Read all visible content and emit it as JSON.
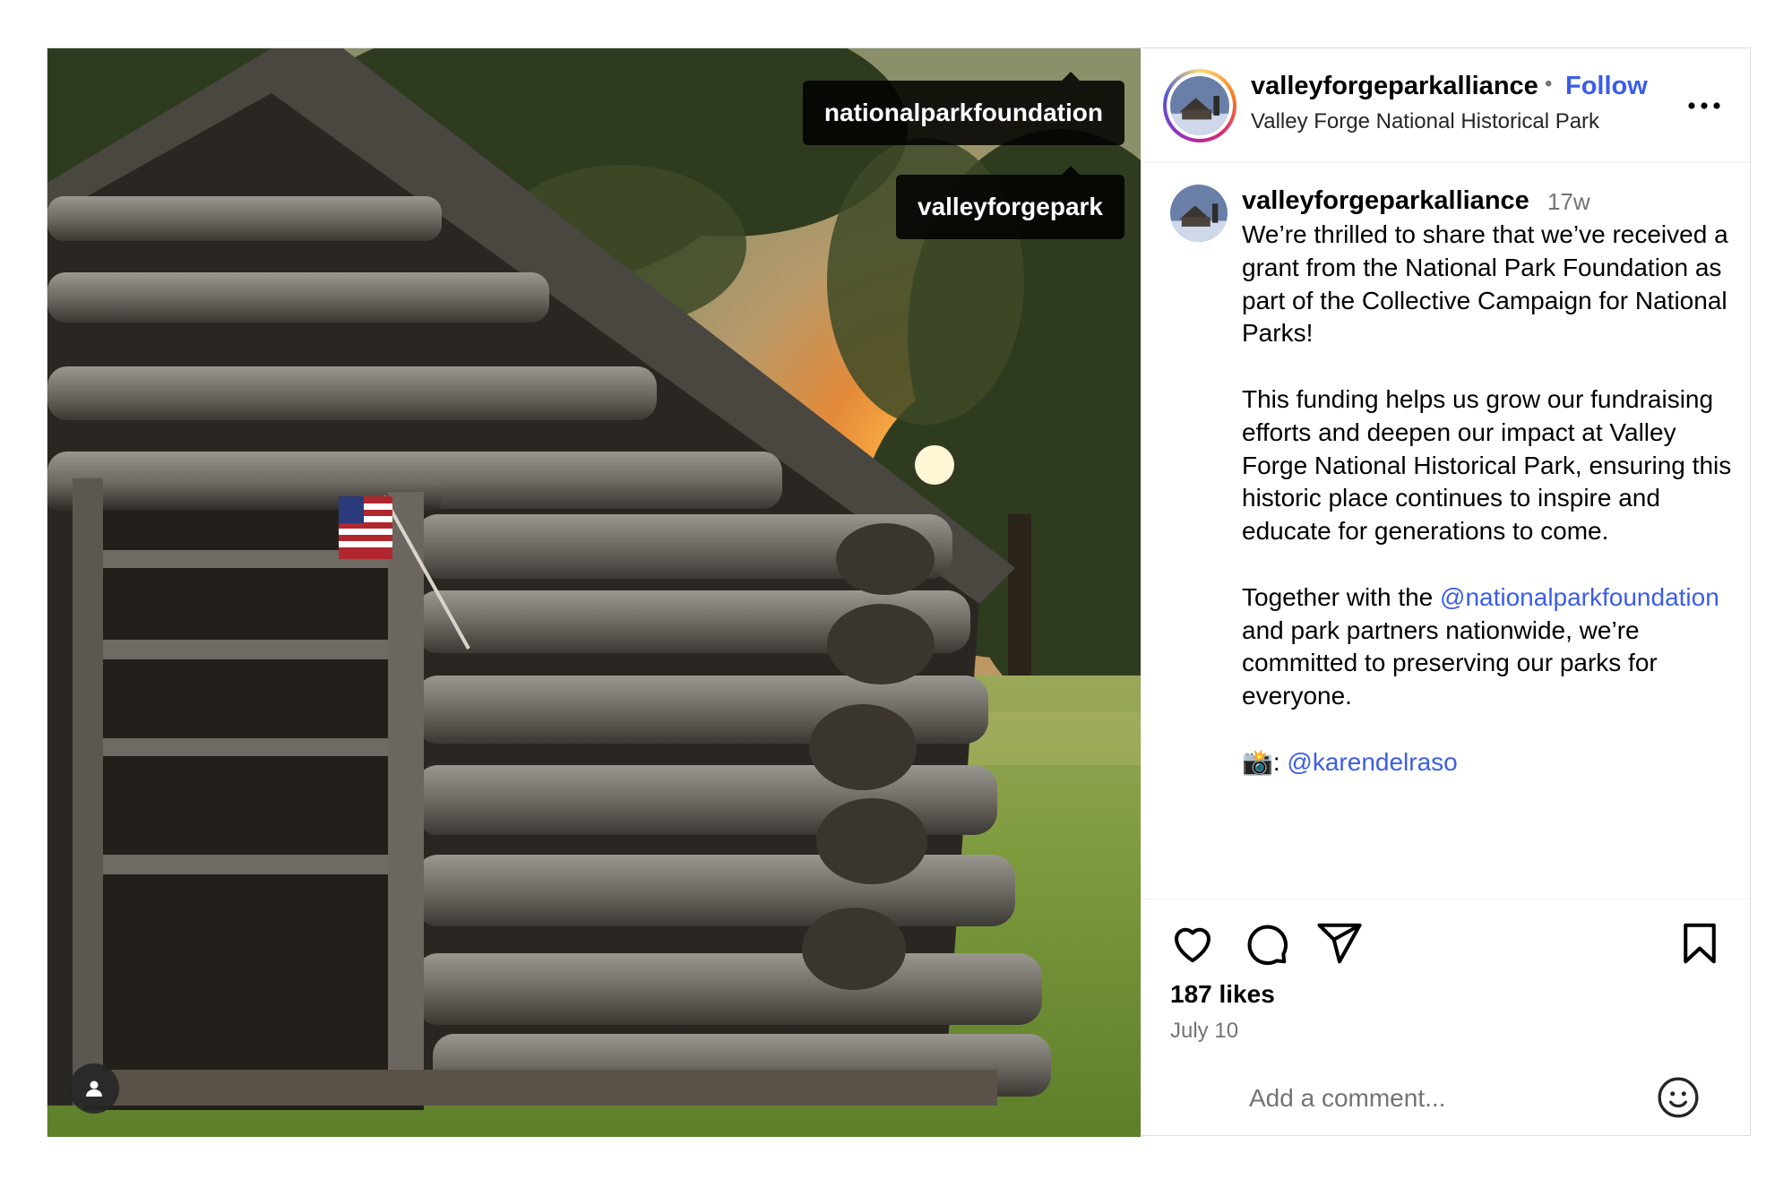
{
  "post": {
    "account": {
      "username": "valleyforgeparkalliance",
      "separator": "•",
      "follow_label": "Follow",
      "location": "Valley Forge National Historical Park"
    },
    "media": {
      "tags": [
        "nationalparkfoundation",
        "valleyforgepark"
      ]
    },
    "caption": {
      "username": "valleyforgeparkalliance",
      "time_ago": "17w",
      "paragraph_1": "We’re thrilled to share that we’ve received a grant from the National Park Foundation as part of the Collective Campaign for National Parks!",
      "paragraph_2": "This funding helps us grow our fundraising efforts and deepen our impact at Valley Forge National Historical Park, ensuring this historic place continues to inspire and educate for generations to come.",
      "paragraph_3_before": "Together with the ",
      "mention_1": "@nationalparkfoundation",
      "paragraph_3_after": " and park partners nationwide, we’re committed to preserving our parks for everyone.",
      "photo_credit_prefix": "📸: ",
      "mention_2": "@karendelraso"
    },
    "likes": "187 likes",
    "date": "July 10",
    "comment": {
      "placeholder": "Add a comment..."
    }
  },
  "icons": {
    "tagged_users": "person-icon",
    "like": "heart-icon",
    "comment": "comment-bubble-icon",
    "share": "paper-plane-icon",
    "save": "bookmark-icon",
    "more": "more-options-icon",
    "emoji": "smiley-icon"
  },
  "colors": {
    "link": "#3b5de7",
    "secondary_text": "#737373",
    "border": "#dbdbdb"
  }
}
